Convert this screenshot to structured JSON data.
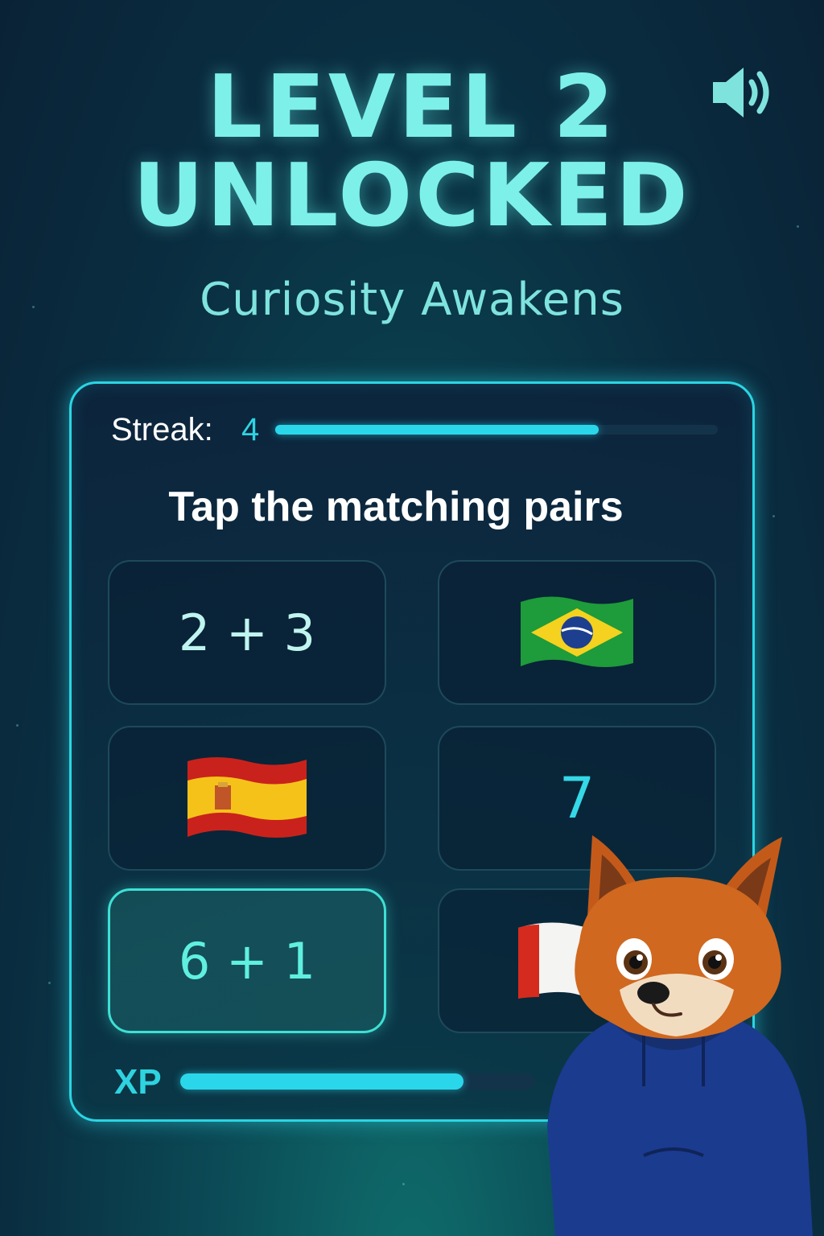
{
  "header": {
    "title_line1": "LEVEL 2",
    "title_line2": "UNLOCKED",
    "subtitle": "Curiosity Awakens",
    "sound_icon": "speaker-volume-icon"
  },
  "game": {
    "streak_label": "Streak:",
    "streak_value": "4",
    "streak_progress": 0.73,
    "instruction": "Tap the matching pairs",
    "tiles": [
      {
        "type": "text",
        "label": "2 + 3"
      },
      {
        "type": "flag",
        "flag": "brazil-flag-icon"
      },
      {
        "type": "flag",
        "flag": "spain-flag-icon"
      },
      {
        "type": "text",
        "label": "7"
      },
      {
        "type": "text",
        "label": "6 + 1",
        "selected": true
      },
      {
        "type": "flag",
        "flag": "canada-flag-icon"
      }
    ],
    "xp_label": "XP",
    "xp_progress": 0.8
  },
  "mascot": "fox-mascot-in-blue-hoodie",
  "colors": {
    "accent": "#2ad7ea",
    "title": "#7ef0ea",
    "background": "#0a2d40"
  }
}
